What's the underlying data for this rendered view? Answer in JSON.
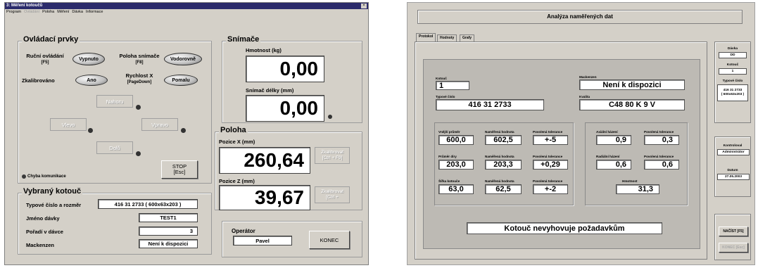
{
  "left": {
    "title": "3: Měření kotoučů",
    "menu": [
      "Program",
      "Ovládání",
      "Poloha",
      "Měření",
      "Dávka",
      "Informace"
    ],
    "controls": {
      "title": "Ovládací prvky",
      "manual_label": "Ruční ovládání",
      "manual_key": "[F5]",
      "manual_value": "Vypnuto",
      "sensor_pos_label": "Poloha snímače",
      "sensor_pos_key": "[F8]",
      "sensor_pos_value": "Vodorovně",
      "calibrated_label": "Zkalibrováno",
      "calibrated_value": "Ano",
      "speed_label": "Rychlost X",
      "speed_key": "[PageDown]",
      "speed_value": "Pomalu",
      "up": "Nahoru",
      "left": "Vlevo",
      "right": "Vpravo",
      "down": "Dolů",
      "stop": "STOP",
      "stop_key": "[Esc]",
      "comm_error": "Chyba komunikace"
    },
    "sensors": {
      "title": "Snímače",
      "weight_label": "Hmotnost (kg)",
      "weight_value": "0,00",
      "length_label": "Snímač délky (mm)",
      "length_value": "0,00"
    },
    "position": {
      "title": "Poloha",
      "x_label": "Pozice X (mm)",
      "x_value": "260,64",
      "x_button": "Zkalibrovat",
      "x_button_key": "[Ctrl + F9]",
      "z_label": "Pozice Z (mm)",
      "z_value": "39,67",
      "z_button": "Zkalibrovat",
      "z_button_key": "[Ctrl +"
    },
    "selected": {
      "title": "Vybraný kotouč",
      "type_label": "Typové číslo a rozměr",
      "type_value": "416 31 2733 ( 600x63x203 )",
      "batch_label": "Jméno dávky",
      "batch_value": "TEST1",
      "order_label": "Pořadí v dávce",
      "order_value": "3",
      "mackenzen_label": "Mackenzen",
      "mackenzen_value": "Není k dispozici"
    },
    "operator": {
      "title": "Operátor",
      "value": "Pavel",
      "end": "KONEC"
    }
  },
  "right": {
    "header": "Analýza naměřených dat",
    "tabs": [
      "Protokol",
      "Hodnoty",
      "Grafy"
    ],
    "kotouc_label": "Kotouč",
    "kotouc_value": "1",
    "mackenzen_label": "Mackenzen",
    "mackenzen_value": "Není k dispozici",
    "type_label": "Typové číslo",
    "type_value": "416 31 2733",
    "quality_label": "Kvalita",
    "quality_value": "C48 80 K 9 V",
    "measure": [
      {
        "name": "Vnější průměr",
        "measured_label": "Naměřená hodnota",
        "tol_label": "Povolená tolerance",
        "name_value": "600,0",
        "measured": "602,5",
        "tol": "+-5"
      },
      {
        "name": "Průměr díry",
        "measured_label": "Naměřená hodnota",
        "tol_label": "Povolená tolerance",
        "name_value": "203,0",
        "measured": "203,3",
        "tol": "+0,29"
      },
      {
        "name": "Šířka kotouče",
        "measured_label": "Naměřená hodnota",
        "tol_label": "Povolená tolerance",
        "name_value": "63,0",
        "measured": "62,5",
        "tol": "+-2"
      }
    ],
    "runout": [
      {
        "label": "Axiální házení",
        "tol_label": "Povolená tolerance",
        "value": "0,9",
        "tol": "0,3"
      },
      {
        "label": "Radiální házení",
        "tol_label": "Povolená tolerance",
        "value": "0,6",
        "tol": "0,6"
      }
    ],
    "weight_label": "Hmotnost",
    "weight_value": "31,3",
    "verdict": "Kotouč nevyhovuje požadavkům",
    "side": {
      "batch_label": "Dávka",
      "batch_value": "DD",
      "kotouc_label": "Kotouč",
      "kotouc_value": "1",
      "type_label": "Typové číslo",
      "type_value_1": "416 31 2733",
      "type_value_2": "( 600x63x203 )",
      "controller_label": "Kontroloval",
      "controller_value": "Administrátor",
      "date_label": "Datum",
      "date_value": "27.05.2003",
      "load": "NAČÍST [F5]",
      "end": "KONEC [Esc]"
    }
  }
}
